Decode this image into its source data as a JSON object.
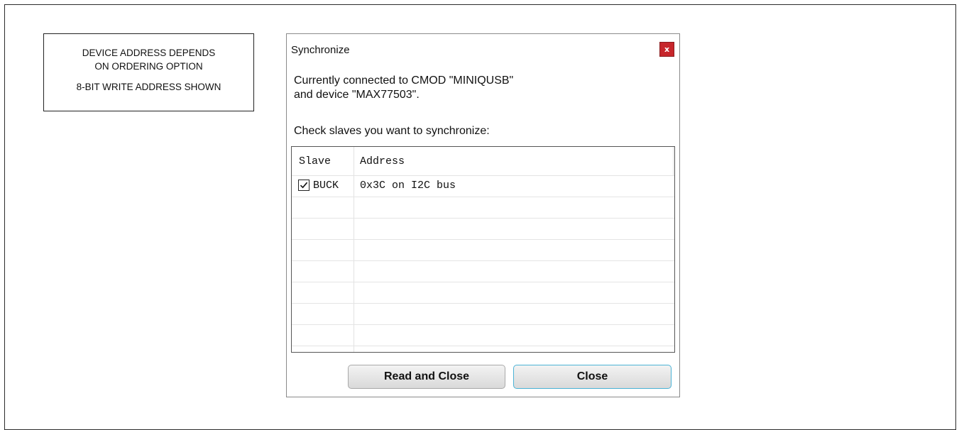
{
  "note": {
    "line1": "DEVICE ADDRESS DEPENDS",
    "line2": "ON ORDERING OPTION",
    "line3": "8-BIT WRITE ADDRESS SHOWN"
  },
  "dialog": {
    "title": "Synchronize",
    "close_glyph": "x",
    "message_line1": "Currently connected to CMOD \"MINIQUSB\"",
    "message_line2": "and device \"MAX77503\".",
    "prompt": "Check slaves you want to synchronize:",
    "columns": [
      "Slave",
      "Address"
    ],
    "rows": [
      {
        "checked": true,
        "slave": "BUCK",
        "address": "0x3C on I2C bus"
      }
    ],
    "buttons": {
      "read_and_close": "Read and Close",
      "close": "Close"
    },
    "colors": {
      "close_button_bg": "#c7262b",
      "focus_border": "#4bb3d6"
    }
  }
}
